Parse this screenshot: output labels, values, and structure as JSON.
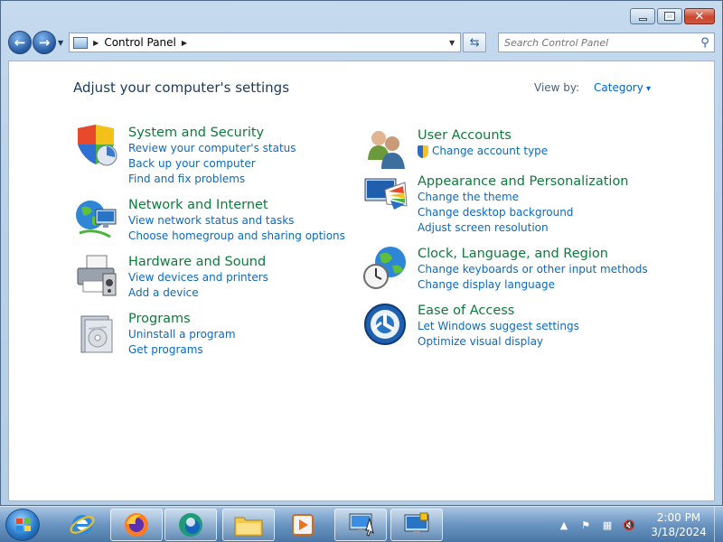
{
  "window": {
    "caption": {
      "minimize": "minimize",
      "maximize": "maximize",
      "close": "close"
    }
  },
  "nav": {
    "back_icon": "back-arrow-icon",
    "forward_icon": "forward-arrow-icon",
    "breadcrumb": [
      "Control Panel"
    ],
    "search_placeholder": "Search Control Panel"
  },
  "content": {
    "heading": "Adjust your computer's settings",
    "view_by_label": "View by:",
    "view_by_value": "Category",
    "left_categories": [
      {
        "title": "System and Security",
        "icon": "shield-icon",
        "links": [
          "Review your computer's status",
          "Back up your computer",
          "Find and fix problems"
        ]
      },
      {
        "title": "Network and Internet",
        "icon": "globe-network-icon",
        "links": [
          "View network status and tasks",
          "Choose homegroup and sharing options"
        ]
      },
      {
        "title": "Hardware and Sound",
        "icon": "printer-icon",
        "links": [
          "View devices and printers",
          "Add a device"
        ]
      },
      {
        "title": "Programs",
        "icon": "programs-box-icon",
        "links": [
          "Uninstall a program",
          "Get programs"
        ]
      }
    ],
    "right_categories": [
      {
        "title": "User Accounts",
        "icon": "users-icon",
        "links": [
          "Change account type"
        ]
      },
      {
        "title": "Appearance and Personalization",
        "icon": "monitor-palette-icon",
        "links": [
          "Change the theme",
          "Change desktop background",
          "Adjust screen resolution"
        ]
      },
      {
        "title": "Clock, Language, and Region",
        "icon": "clock-globe-icon",
        "links": [
          "Change keyboards or other input methods",
          "Change display language"
        ]
      },
      {
        "title": "Ease of Access",
        "icon": "ease-of-access-icon",
        "links": [
          "Let Windows suggest settings",
          "Optimize visual display"
        ]
      }
    ]
  },
  "taskbar": {
    "pinned": [
      "internet-explorer-icon",
      "firefox-icon",
      "edge-icon",
      "file-explorer-icon",
      "media-player-icon",
      "control-panel-icon",
      "remote-desktop-icon"
    ],
    "clock_time": "2:00 PM",
    "clock_date": "3/18/2024",
    "colors": {
      "accent": "#0a6ac0",
      "title_green": "#0e7a3b"
    }
  }
}
